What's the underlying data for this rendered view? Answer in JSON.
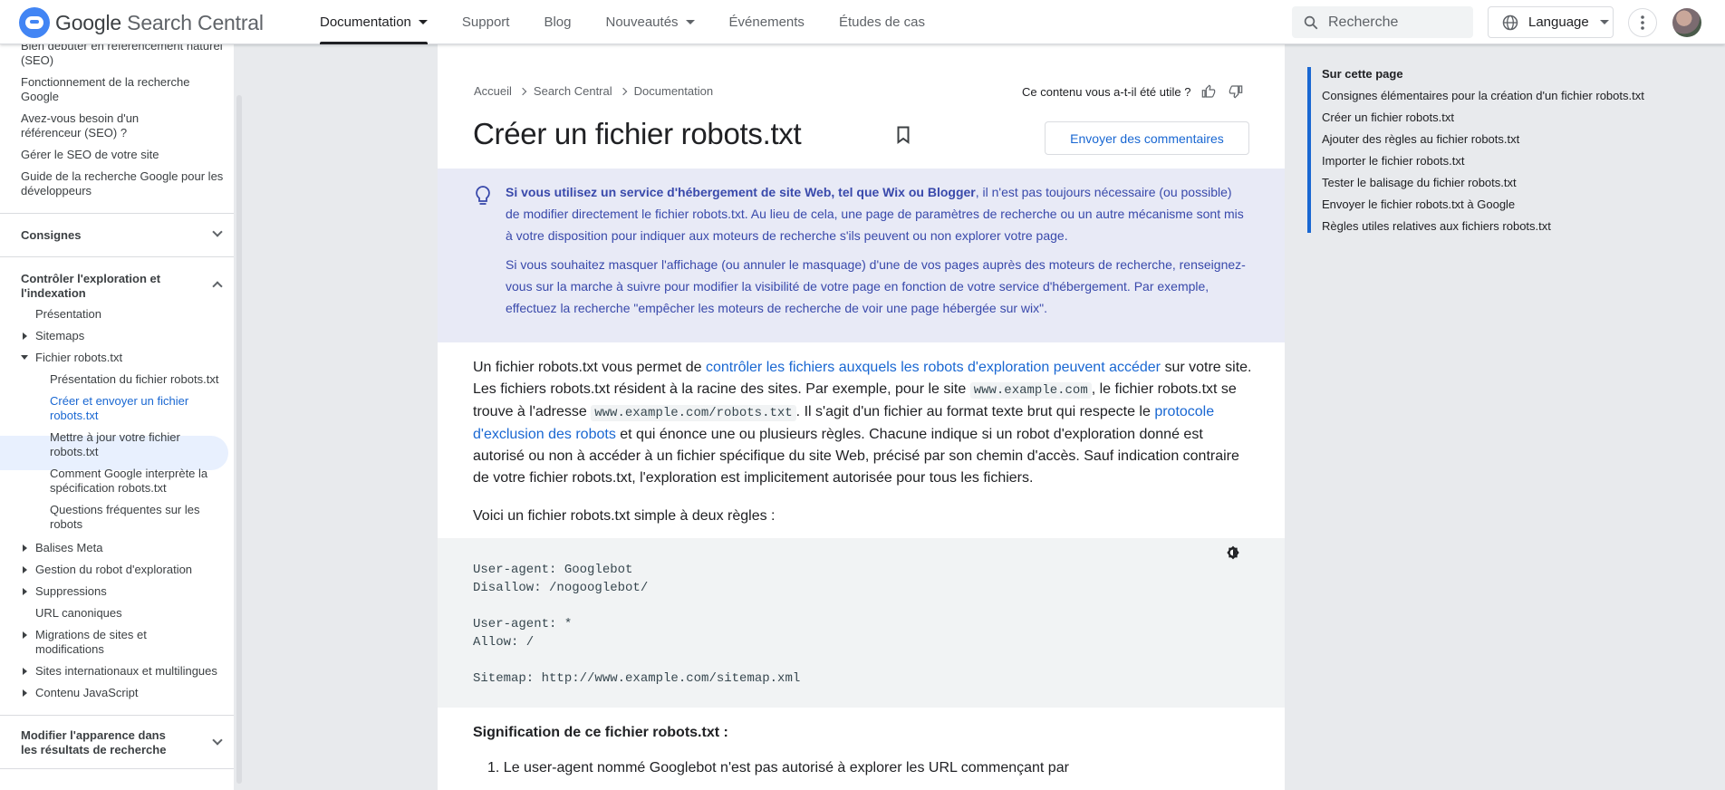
{
  "header": {
    "brand": "Google",
    "brand_suffix": "Search Central",
    "nav": [
      {
        "label": "Documentation",
        "dropdown": true,
        "active": true
      },
      {
        "label": "Support"
      },
      {
        "label": "Blog"
      },
      {
        "label": "Nouveautés",
        "dropdown": true
      },
      {
        "label": "Événements"
      },
      {
        "label": "Études de cas"
      }
    ],
    "search_placeholder": "Recherche",
    "language_label": "Language"
  },
  "sidebar": {
    "top_items": [
      "Bien débuter en référencement naturel (SEO)",
      "Fonctionnement de la recherche Google",
      "Avez-vous besoin d'un référenceur (SEO) ?",
      "Gérer le SEO de votre site",
      "Guide de la recherche Google pour les développeurs"
    ],
    "section_consignes": "Consignes",
    "section_controle": "Contrôler l'exploration et l'indexation",
    "controle_items": [
      "Présentation",
      "Sitemaps",
      "Fichier robots.txt",
      "Présentation du fichier robots.txt",
      "Créer et envoyer un fichier robots.txt",
      "Mettre à jour votre fichier robots.txt",
      "Comment Google interprète la spécification robots.txt",
      "Questions fréquentes sur les robots",
      "Balises Meta",
      "Gestion du robot d'exploration",
      "Suppressions",
      "URL canoniques",
      "Migrations de sites et modifications",
      "Sites internationaux et multilingues",
      "Contenu JavaScript"
    ],
    "section_apparence": "Modifier l'apparence dans les résultats de recherche"
  },
  "content": {
    "breadcrumb": [
      "Accueil",
      "Search Central",
      "Documentation"
    ],
    "helpful_question": "Ce contenu vous a-t-il été utile ?",
    "title": "Créer un fichier robots.txt",
    "feedback_button": "Envoyer des commentaires",
    "note_bold": "Si vous utilisez un service d'hébergement de site Web, tel que Wix ou Blogger",
    "note_rest": ", il n'est pas toujours nécessaire (ou possible) de modifier directement le fichier robots.txt. Au lieu de cela, une page de paramètres de recherche ou un autre mécanisme sont mis à votre disposition pour indiquer aux moteurs de recherche s'ils peuvent ou non explorer votre page.",
    "note_2": "Si vous souhaitez masquer l'affichage (ou annuler le masquage) d'une de vos pages auprès des moteurs de recherche, renseignez-vous sur la marche à suivre pour modifier la visibilité de votre page en fonction de votre service d'hébergement. Par exemple, effectuez la recherche \"empêcher les moteurs de recherche de voir une page hébergée sur wix\".",
    "p1_a": "Un fichier robots.txt vous permet de ",
    "p1_link1": "contrôler les fichiers auxquels les robots d'exploration peuvent accéder",
    "p1_b": " sur votre site. Les fichiers robots.txt résident à la racine des sites. Par exemple, pour le site ",
    "p1_code1": "www.example.com",
    "p1_c": ", le fichier robots.txt se trouve à l'adresse ",
    "p1_code2": "www.example.com/robots.txt",
    "p1_d": ". Il s'agit d'un fichier au format texte brut qui respecte le ",
    "p1_link2": "protocole d'exclusion des robots",
    "p1_e": " et qui énonce une ou plusieurs règles. Chacune indique si un robot d'exploration donné est autorisé ou non à accéder à un fichier spécifique du site Web, précisé par son chemin d'accès. Sauf indication contraire de votre fichier robots.txt, l'exploration est implicitement autorisée pour tous les fichiers.",
    "p2": "Voici un fichier robots.txt simple à deux règles :",
    "code": "User-agent: Googlebot\nDisallow: /nogooglebot/\n\nUser-agent: *\nAllow: /\n\nSitemap: http://www.example.com/sitemap.xml",
    "subheading": "Signification de ce fichier robots.txt :",
    "list_1": "Le user-agent nommé Googlebot n'est pas autorisé à explorer les URL commençant par"
  },
  "toc": {
    "heading": "Sur cette page",
    "items": [
      "Consignes élémentaires pour la création d'un fichier robots.txt",
      "Créer un fichier robots.txt",
      "Ajouter des règles au fichier robots.txt",
      "Importer le fichier robots.txt",
      "Tester le balisage du fichier robots.txt",
      "Envoyer le fichier robots.txt à Google",
      "Règles utiles relatives aux fichiers robots.txt"
    ]
  },
  "colors": {
    "accent": "#1967d2",
    "note_bg": "#e8eaf6",
    "note_text": "#3949ab",
    "page_bg": "#e8eaed"
  }
}
